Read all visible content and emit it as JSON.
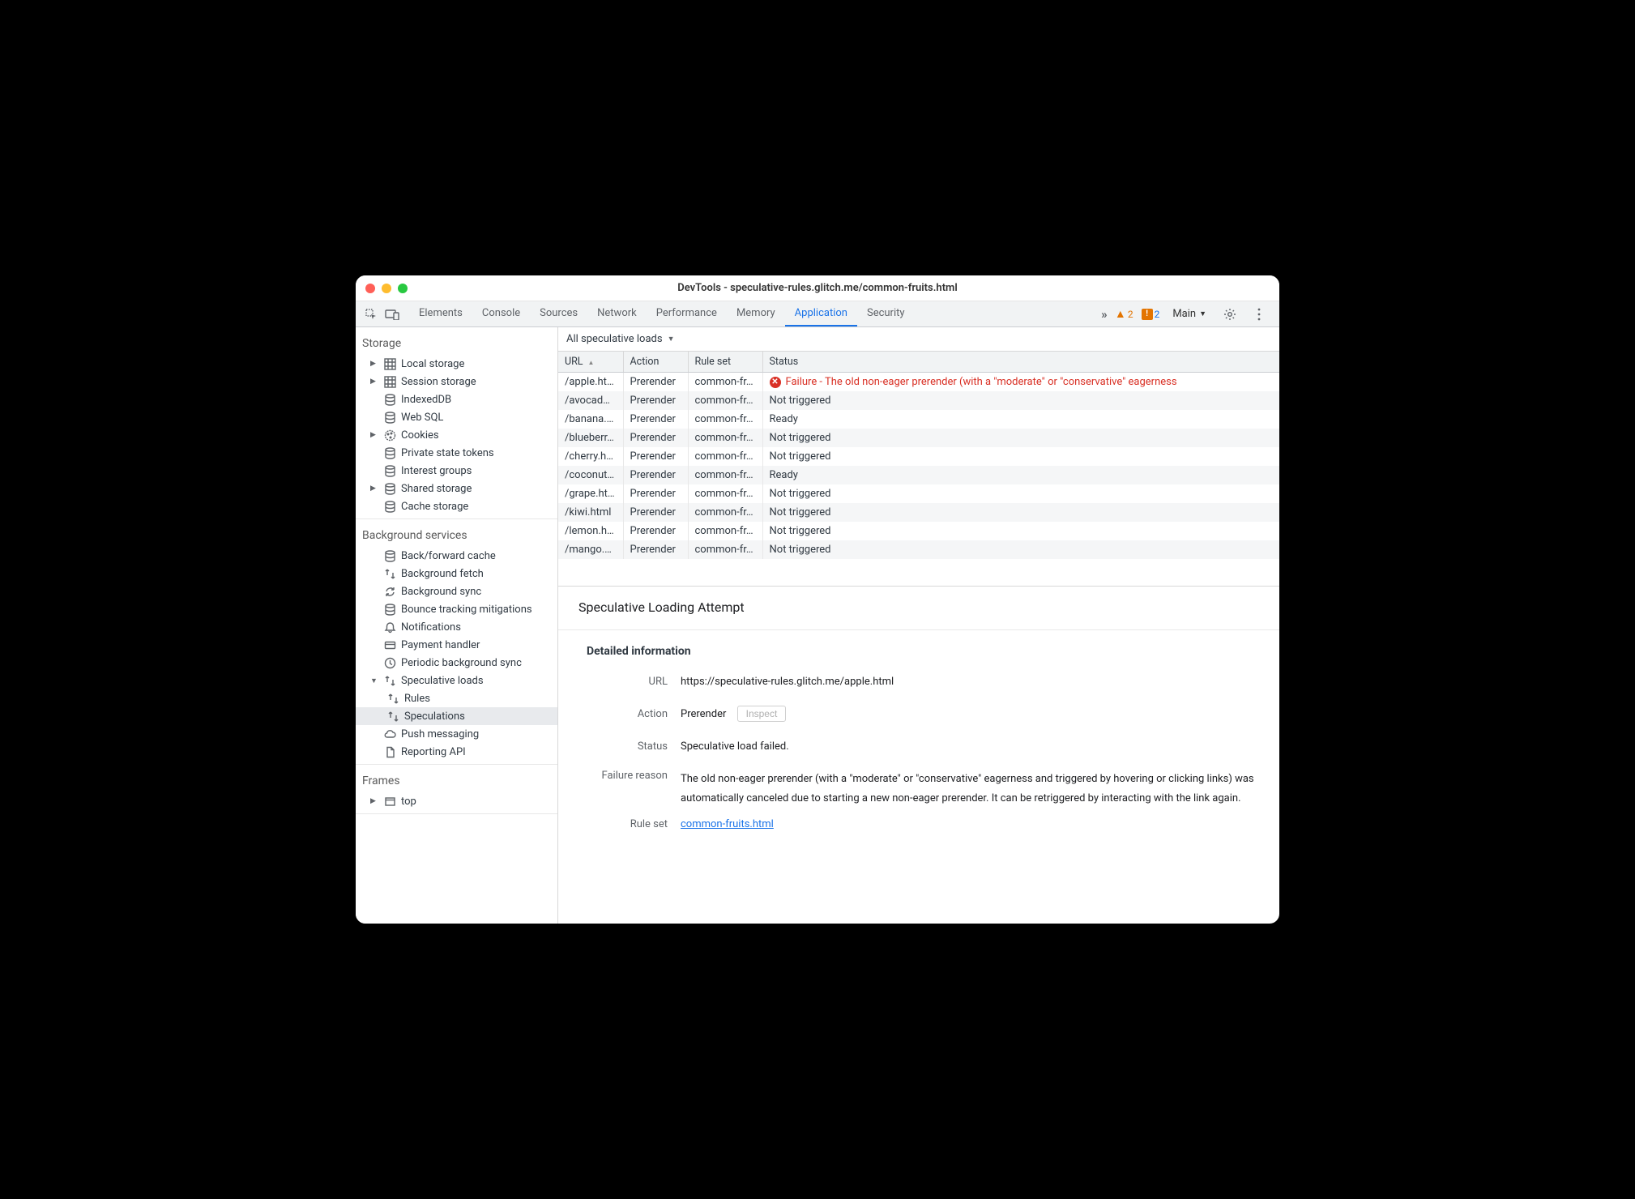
{
  "window": {
    "title": "DevTools - speculative-rules.glitch.me/common-fruits.html"
  },
  "toolbar": {
    "tabs": [
      "Elements",
      "Console",
      "Sources",
      "Network",
      "Performance",
      "Memory",
      "Application",
      "Security"
    ],
    "active_tab": "Application",
    "more": "»",
    "warn_count": "2",
    "info_count": "2",
    "frame_selector": "Main"
  },
  "sidebar": {
    "sections": [
      {
        "heading": "Storage",
        "items": [
          {
            "label": "Local storage",
            "icon": "grid",
            "expandable": true
          },
          {
            "label": "Session storage",
            "icon": "grid",
            "expandable": true
          },
          {
            "label": "IndexedDB",
            "icon": "db"
          },
          {
            "label": "Web SQL",
            "icon": "db"
          },
          {
            "label": "Cookies",
            "icon": "cookie",
            "expandable": true
          },
          {
            "label": "Private state tokens",
            "icon": "db"
          },
          {
            "label": "Interest groups",
            "icon": "db"
          },
          {
            "label": "Shared storage",
            "icon": "db",
            "expandable": true
          },
          {
            "label": "Cache storage",
            "icon": "db"
          }
        ]
      },
      {
        "heading": "Background services",
        "items": [
          {
            "label": "Back/forward cache",
            "icon": "db"
          },
          {
            "label": "Background fetch",
            "icon": "arrows"
          },
          {
            "label": "Background sync",
            "icon": "sync"
          },
          {
            "label": "Bounce tracking mitigations",
            "icon": "db"
          },
          {
            "label": "Notifications",
            "icon": "bell"
          },
          {
            "label": "Payment handler",
            "icon": "card"
          },
          {
            "label": "Periodic background sync",
            "icon": "clock"
          },
          {
            "label": "Speculative loads",
            "icon": "arrows",
            "expandable": true,
            "expanded": true,
            "children": [
              {
                "label": "Rules",
                "icon": "arrows"
              },
              {
                "label": "Speculations",
                "icon": "arrows",
                "selected": true
              }
            ]
          },
          {
            "label": "Push messaging",
            "icon": "cloud"
          },
          {
            "label": "Reporting API",
            "icon": "doc"
          }
        ]
      },
      {
        "heading": "Frames",
        "items": [
          {
            "label": "top",
            "icon": "frame",
            "expandable": true
          }
        ]
      }
    ]
  },
  "content": {
    "filter_label": "All speculative loads",
    "columns": [
      "URL",
      "Action",
      "Rule set",
      "Status"
    ],
    "col_widths": [
      "80px",
      "80px",
      "92px",
      "auto"
    ],
    "rows": [
      {
        "url": "/apple.html",
        "action": "Prerender",
        "ruleset": "common-fr…",
        "status": "Failure - The old non-eager prerender (with a \"moderate\" or \"conservative\" eagerness",
        "error": true
      },
      {
        "url": "/avocad…",
        "action": "Prerender",
        "ruleset": "common-fr…",
        "status": "Not triggered"
      },
      {
        "url": "/banana.…",
        "action": "Prerender",
        "ruleset": "common-fr…",
        "status": "Ready"
      },
      {
        "url": "/blueberr…",
        "action": "Prerender",
        "ruleset": "common-fr…",
        "status": "Not triggered"
      },
      {
        "url": "/cherry.h…",
        "action": "Prerender",
        "ruleset": "common-fr…",
        "status": "Not triggered"
      },
      {
        "url": "/coconut…",
        "action": "Prerender",
        "ruleset": "common-fr…",
        "status": "Ready"
      },
      {
        "url": "/grape.html",
        "action": "Prerender",
        "ruleset": "common-fr…",
        "status": "Not triggered"
      },
      {
        "url": "/kiwi.html",
        "action": "Prerender",
        "ruleset": "common-fr…",
        "status": "Not triggered"
      },
      {
        "url": "/lemon.h…",
        "action": "Prerender",
        "ruleset": "common-fr…",
        "status": "Not triggered"
      },
      {
        "url": "/mango.…",
        "action": "Prerender",
        "ruleset": "common-fr…",
        "status": "Not triggered"
      }
    ]
  },
  "detail": {
    "title": "Speculative Loading Attempt",
    "subhead": "Detailed information",
    "fields": {
      "url_label": "URL",
      "url_value": "https://speculative-rules.glitch.me/apple.html",
      "action_label": "Action",
      "action_value": "Prerender",
      "inspect_label": "Inspect",
      "status_label": "Status",
      "status_value": "Speculative load failed.",
      "failure_label": "Failure reason",
      "failure_value": "The old non-eager prerender (with a \"moderate\" or \"conservative\" eagerness and triggered by hovering or clicking links) was automatically canceled due to starting a new non-eager prerender. It can be retriggered by interacting with the link again.",
      "ruleset_label": "Rule set",
      "ruleset_value": "common-fruits.html"
    }
  }
}
